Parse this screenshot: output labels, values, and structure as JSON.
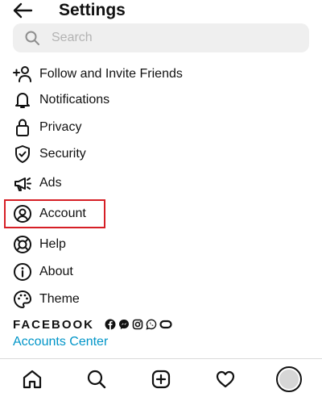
{
  "header": {
    "back_icon": "arrow-left-icon",
    "title": "Settings"
  },
  "search": {
    "placeholder": "Search",
    "value": "",
    "icon": "search-icon"
  },
  "menu": [
    {
      "label": "Follow and Invite Friends",
      "icon": "add-person-icon"
    },
    {
      "label": "Notifications",
      "icon": "bell-icon"
    },
    {
      "label": "Privacy",
      "icon": "lock-icon"
    },
    {
      "label": "Security",
      "icon": "shield-check-icon"
    },
    {
      "label": "Ads",
      "icon": "megaphone-icon"
    },
    {
      "label": "Account",
      "icon": "user-circle-icon",
      "highlighted": true
    },
    {
      "label": "Help",
      "icon": "lifebuoy-icon"
    },
    {
      "label": "About",
      "icon": "info-icon"
    },
    {
      "label": "Theme",
      "icon": "palette-icon"
    }
  ],
  "facebook": {
    "wordmark": "FACEBOOK",
    "app_icons": [
      "facebook-icon",
      "messenger-icon",
      "instagram-icon",
      "whatsapp-icon",
      "portal-icon"
    ]
  },
  "accounts_center": "Accounts Center",
  "bottom_nav": [
    "home-icon",
    "search-icon",
    "create-post-icon",
    "heart-icon",
    "profile-avatar"
  ],
  "colors": {
    "highlight_border": "#d61f26",
    "link": "#0095c8",
    "search_bg": "#efefef",
    "text": "#111111"
  }
}
